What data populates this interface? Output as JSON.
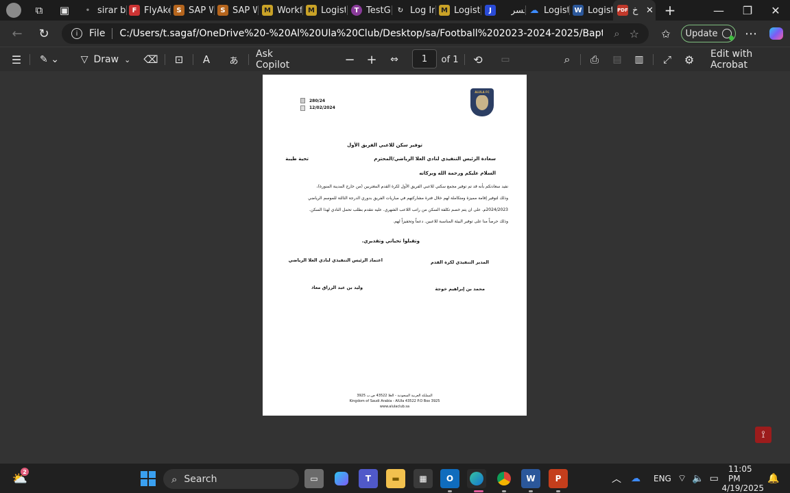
{
  "browser": {
    "tabs": [
      {
        "title": "sirar by",
        "icon": "generic-page-icon"
      },
      {
        "title": "FlyAke",
        "icon": "flyakeed-icon"
      },
      {
        "title": "SAP W",
        "icon": "sap-icon"
      },
      {
        "title": "SAP W",
        "icon": "sap-icon"
      },
      {
        "title": "Workfl",
        "icon": "app-icon"
      },
      {
        "title": "Logisti",
        "icon": "app-icon"
      },
      {
        "title": "TestGo",
        "icon": "testgorilla-icon"
      },
      {
        "title": "Log In",
        "icon": "login-icon"
      },
      {
        "title": "Logisti",
        "icon": "app-icon"
      },
      {
        "title": "جسر",
        "icon": "jisr-icon"
      },
      {
        "title": "Logisti",
        "icon": "onedrive-icon"
      },
      {
        "title": "Logisti",
        "icon": "word-icon"
      },
      {
        "title": "خ",
        "icon": "pdf-icon"
      }
    ],
    "address": {
      "scheme_label": "File",
      "url": "C:/Users/t.sagaf/OneDrive%20-%20Al%20Ula%20Club/Desktop/sa/Football%202023-2024-2025/Baptism%20Letters/...خطاب"
    },
    "update_label": "Update"
  },
  "pdf_toolbar": {
    "draw_label": "Draw",
    "copilot_label": "Ask Copilot",
    "page_current": "1",
    "page_total": "of 1",
    "acrobat_label": "Edit with Acrobat"
  },
  "document": {
    "ref_number": "280/24",
    "ref_date": "12/02/2024",
    "subject": "توفير سكن للاعبي الفريق الأول",
    "addressee": "سعادة الرئيس التنفيذي لنادي العلا الرياضي/المحترم",
    "greeting_left": "تحية طيبة",
    "salutation": "السلام عليكم ورحمة الله وبركاته",
    "body_lines": [
      "نفيد سعادتكم بأنه قد تم توفير مجمع سكني للاعبي الفريق الأول لكرة القدم المغتربين (من خارج المدينة المنورة)،",
      "وذلك لتوفير إقامة مميزة ومتكاملة لهم خلال فترة مشاركتهم في مباريات الفريق بدوري الدرجة الثالثة للموسم الرياضي",
      "2024/2023م. على ان يتم خصم تكلفة السكن من راتب اللاعب الشهري. عليه نتقدم بطلب تحمل النادي لهذا السكن.",
      "وذلك حرصاً منا على توفير البيئة المناسبة للاعبين. دعماً وتحفيزاً لهم."
    ],
    "closing": "وتقبلوا تحياتي وتقديري.",
    "sig_right_title": "المدير التنفيذي لكرة القدم",
    "sig_left_title": "اعتماد الرئيس التنفيذي لنادي العلا الرياضي",
    "sig_right_name": "محمد بن إبراهيم خوجة",
    "sig_left_name": "وليد بن عبد الرزاق معاذ",
    "footer_ar": "المملكة العربية السعودية - العلا 43522 ص.ب 3925",
    "footer_en": "Kingdom of Saudi Arabia - AlUla 43522 P.O Box 3925",
    "footer_web": "www.alulaclub.sa",
    "logo_text": "ALULA FC"
  },
  "taskbar": {
    "search_label": "Search",
    "notification_count": "2",
    "language": "ENG",
    "time": "11:05 PM",
    "date": "4/19/2025"
  },
  "colors": {
    "page_bg": "#333333",
    "chrome_bg": "#2d2d2d",
    "update_border": "#7fbf7f",
    "acrobat_red": "#9c1c1c"
  }
}
